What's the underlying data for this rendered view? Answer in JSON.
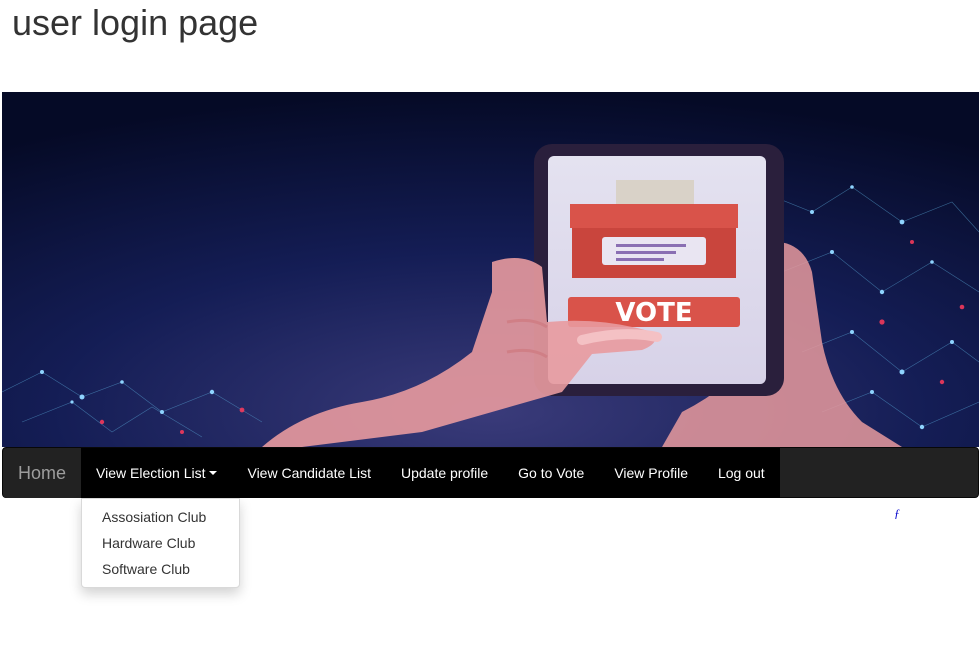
{
  "page": {
    "title": "user login page"
  },
  "banner": {
    "vote_text": "VOTE"
  },
  "navbar": {
    "brand": "Home",
    "items": [
      {
        "label": "View Election List",
        "has_caret": true
      },
      {
        "label": "View Candidate List"
      },
      {
        "label": "Update profile"
      },
      {
        "label": "Go to Vote"
      },
      {
        "label": "View Profile"
      },
      {
        "label": "Log out"
      }
    ]
  },
  "dropdown": {
    "items": [
      {
        "label": "Assosiation Club"
      },
      {
        "label": "Hardware Club"
      },
      {
        "label": "Software Club"
      }
    ]
  },
  "stray_mark": "ƒ",
  "colors": {
    "navbar_bg": "#222222",
    "nav_active_bg": "#000000",
    "vote_red": "#d9534a",
    "banner_dark": "#0b1236"
  }
}
